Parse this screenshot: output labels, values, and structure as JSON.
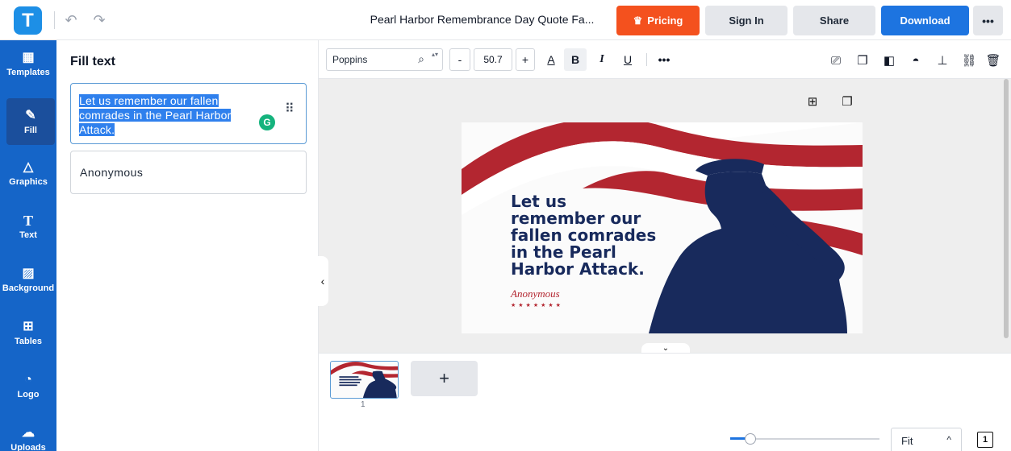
{
  "header": {
    "logo_letter": "T",
    "undo_icon": "↶",
    "redo_icon": "↷",
    "doc_title": "Pearl Harbor Remembrance Day Quote Fa...",
    "pricing_label": "Pricing",
    "pricing_icon": "♛",
    "signin_label": "Sign In",
    "share_label": "Share",
    "download_label": "Download",
    "more_label": "•••"
  },
  "rail": [
    {
      "label": "Templates",
      "icon": "▦"
    },
    {
      "label": "Fill",
      "icon": "✎"
    },
    {
      "label": "Graphics",
      "icon": "△"
    },
    {
      "label": "Text",
      "icon": "T"
    },
    {
      "label": "Background",
      "icon": "▨"
    },
    {
      "label": "Tables",
      "icon": "⊞"
    },
    {
      "label": "Logo",
      "icon": "◔"
    },
    {
      "label": "Uploads",
      "icon": "☁"
    }
  ],
  "panel": {
    "title": "Fill text",
    "field1_lines": [
      "Let us remember our fallen",
      "comrades in the Pearl Harbor",
      "Attack."
    ],
    "grammarly_letter": "G",
    "drag_icon": "⠿",
    "field2_value": "Anonymous"
  },
  "toolbar": {
    "font_name": "Poppins",
    "search_icon": "⌕",
    "spin_icon": "▴▾",
    "minus": "-",
    "font_size": "50.7",
    "plus": "+",
    "text_color": "A",
    "bold": "B",
    "italic": "I",
    "underline": "U",
    "more": "•••",
    "right_icons": [
      "⎚",
      "❐",
      "◧",
      "◓",
      "⊥",
      "⛓",
      "🗑"
    ]
  },
  "stage": {
    "add_icon": "⊞",
    "copy_icon": "❐",
    "collapse_icon": "‹",
    "expand_icon": "⌄"
  },
  "design": {
    "quote_lines": [
      "Let us",
      "remember our",
      "fallen comrades",
      "in the Pearl",
      "Harbor Attack."
    ],
    "author": "Anonymous",
    "stars": "★★★★★★★",
    "colors": {
      "red": "#b32630",
      "navy": "#182a5c"
    }
  },
  "pages": {
    "page_number": "1",
    "add_icon": "+"
  },
  "zoom": {
    "value": "Fit",
    "chevron": "^",
    "pages_icon": "1",
    "level": 0.13
  }
}
